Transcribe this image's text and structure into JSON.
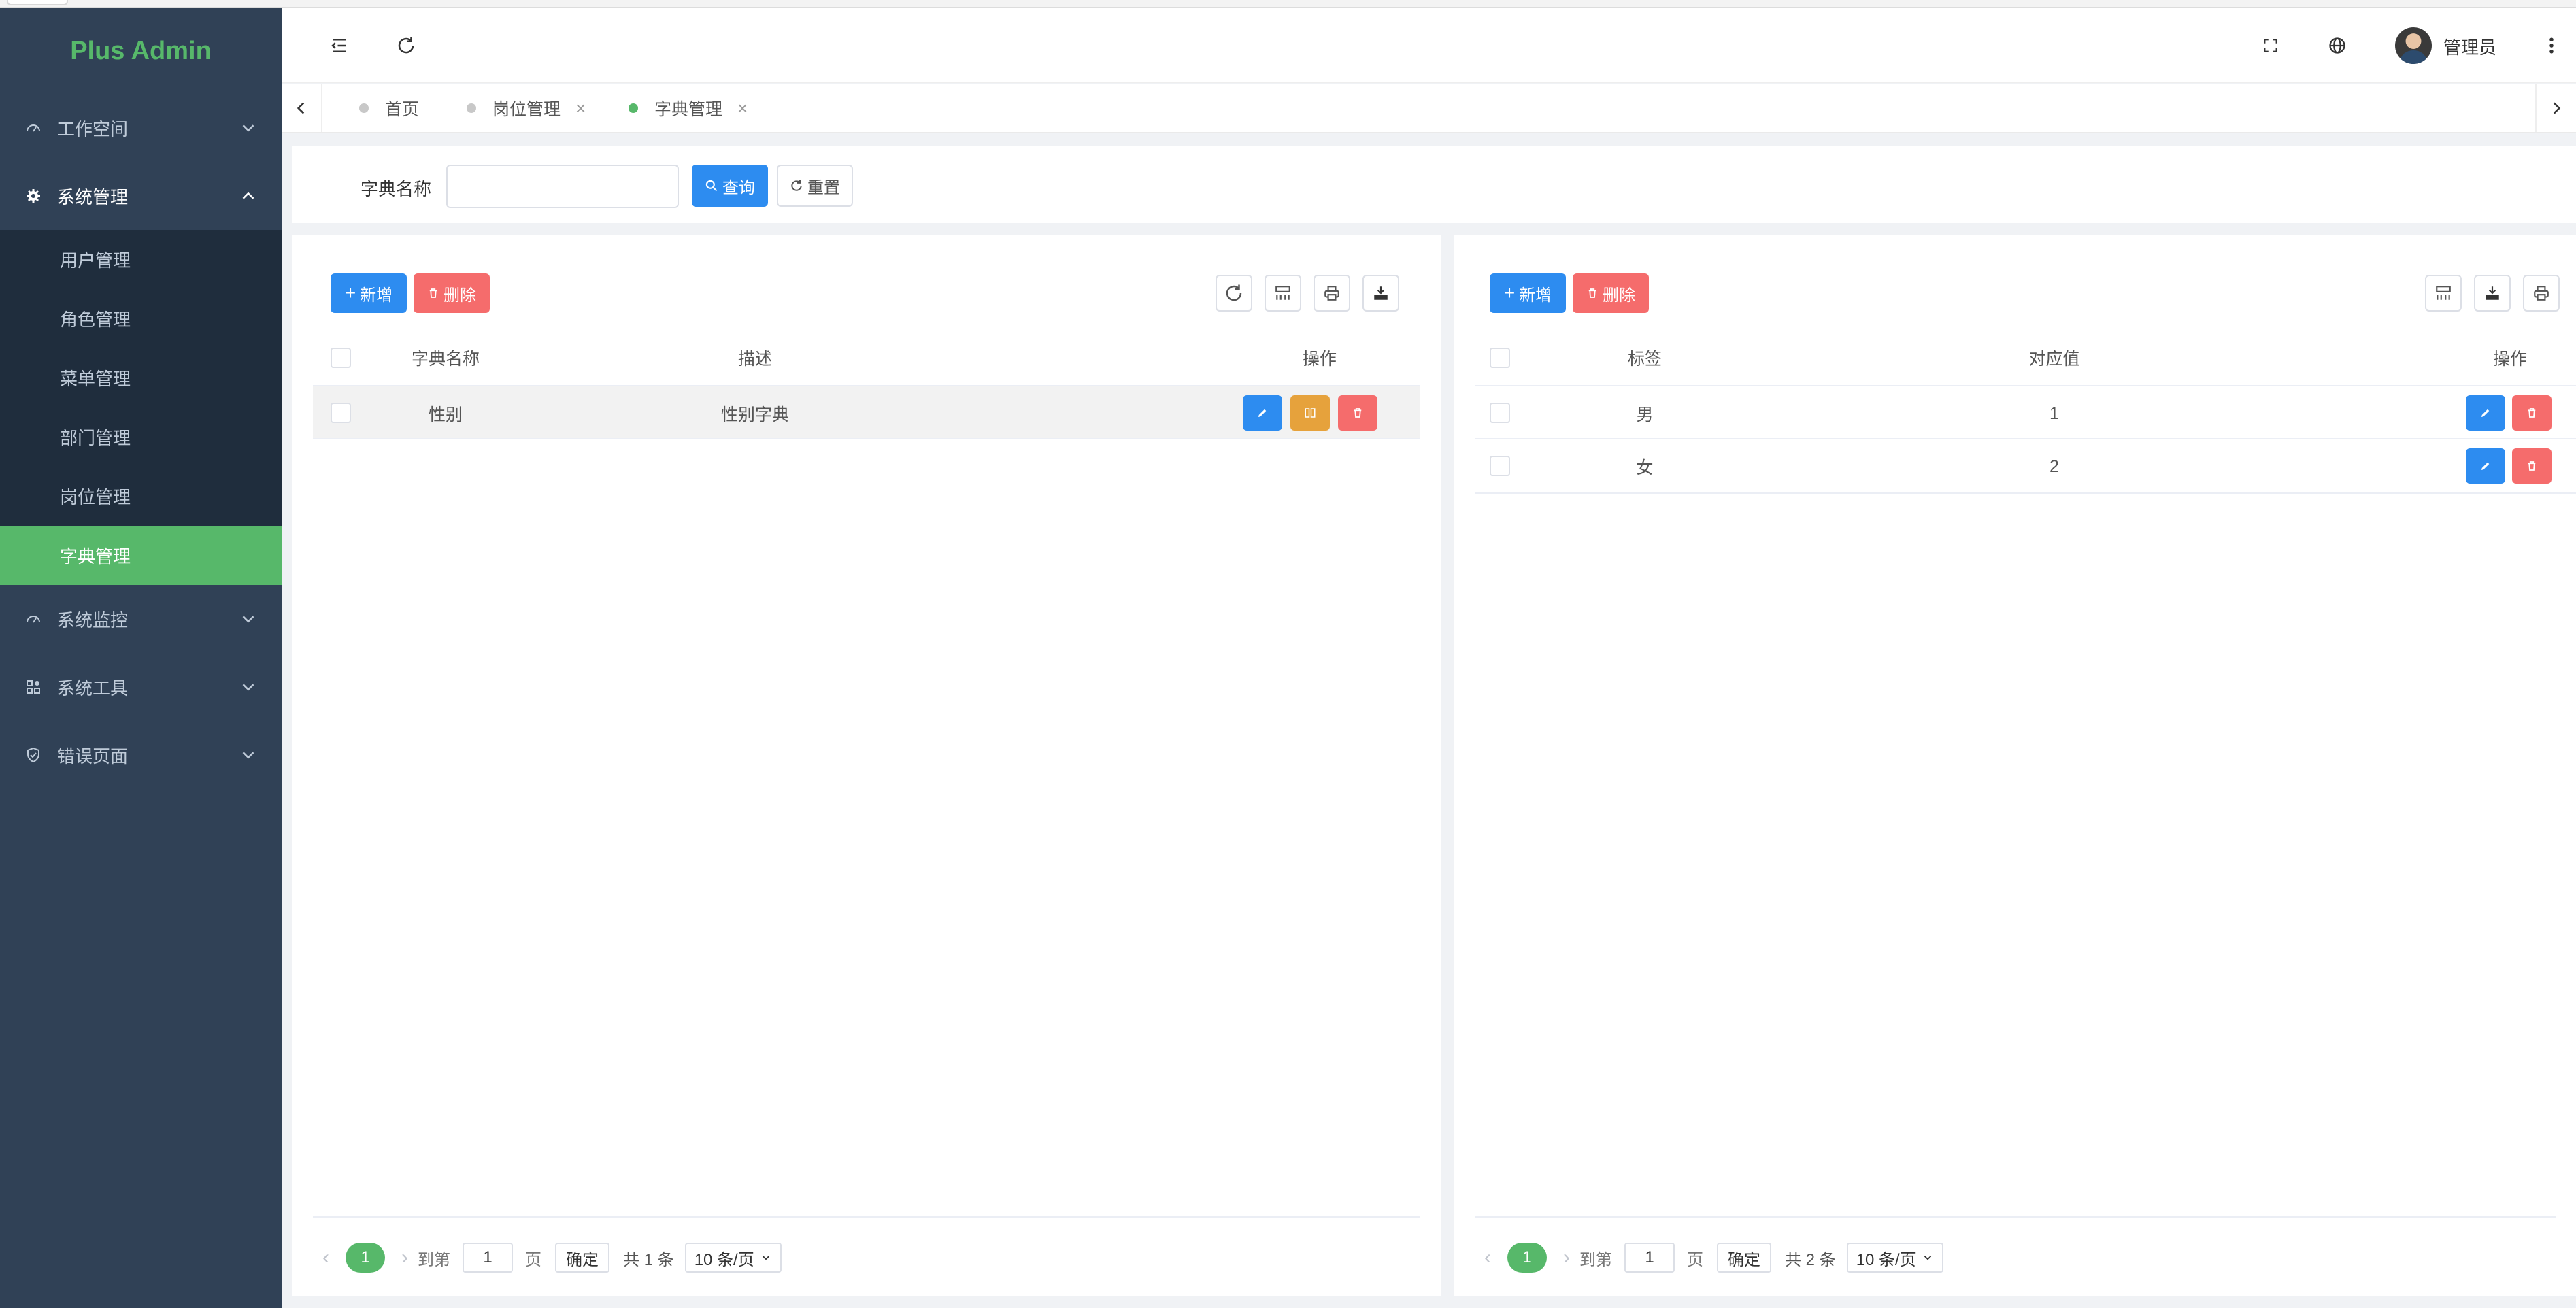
{
  "app": {
    "logo": "Plus Admin",
    "brand_color": "#57b86a",
    "sidebar_bg": "#304156"
  },
  "sidebar": {
    "groups": [
      {
        "label": "工作空间",
        "icon": "dashboard-icon",
        "open": false
      },
      {
        "label": "系统管理",
        "icon": "gear-icon",
        "open": true,
        "items": [
          {
            "label": "用户管理"
          },
          {
            "label": "角色管理"
          },
          {
            "label": "菜单管理"
          },
          {
            "label": "部门管理"
          },
          {
            "label": "岗位管理"
          },
          {
            "label": "字典管理",
            "active": true
          }
        ]
      },
      {
        "label": "系统监控",
        "icon": "dashboard-icon",
        "open": false
      },
      {
        "label": "系统工具",
        "icon": "grid-icon",
        "open": false
      },
      {
        "label": "错误页面",
        "icon": "shield-icon",
        "open": false
      }
    ]
  },
  "header": {
    "user": "管理员"
  },
  "tabs": [
    {
      "label": "首页",
      "closable": false,
      "active": false
    },
    {
      "label": "岗位管理",
      "closable": true,
      "active": false
    },
    {
      "label": "字典管理",
      "closable": true,
      "active": true
    }
  ],
  "search": {
    "label": "字典名称",
    "value": "",
    "query_label": "查询",
    "reset_label": "重置"
  },
  "left_table": {
    "add_label": "新增",
    "delete_label": "删除",
    "columns": [
      "字典名称",
      "描述",
      "操作"
    ],
    "rows": [
      {
        "name": "性别",
        "description": "性别字典"
      }
    ],
    "pager": {
      "current": "1",
      "goto_prefix": "到第",
      "goto_value": "1",
      "goto_suffix": "页",
      "ok": "确定",
      "total": "共 1 条",
      "size": "10 条/页"
    }
  },
  "right_table": {
    "add_label": "新增",
    "delete_label": "删除",
    "columns": [
      "标签",
      "对应值",
      "操作"
    ],
    "rows": [
      {
        "label": "男",
        "value": "1"
      },
      {
        "label": "女",
        "value": "2"
      }
    ],
    "pager": {
      "current": "1",
      "goto_prefix": "到第",
      "goto_value": "1",
      "goto_suffix": "页",
      "ok": "确定",
      "total": "共 2 条",
      "size": "10 条/页"
    }
  }
}
